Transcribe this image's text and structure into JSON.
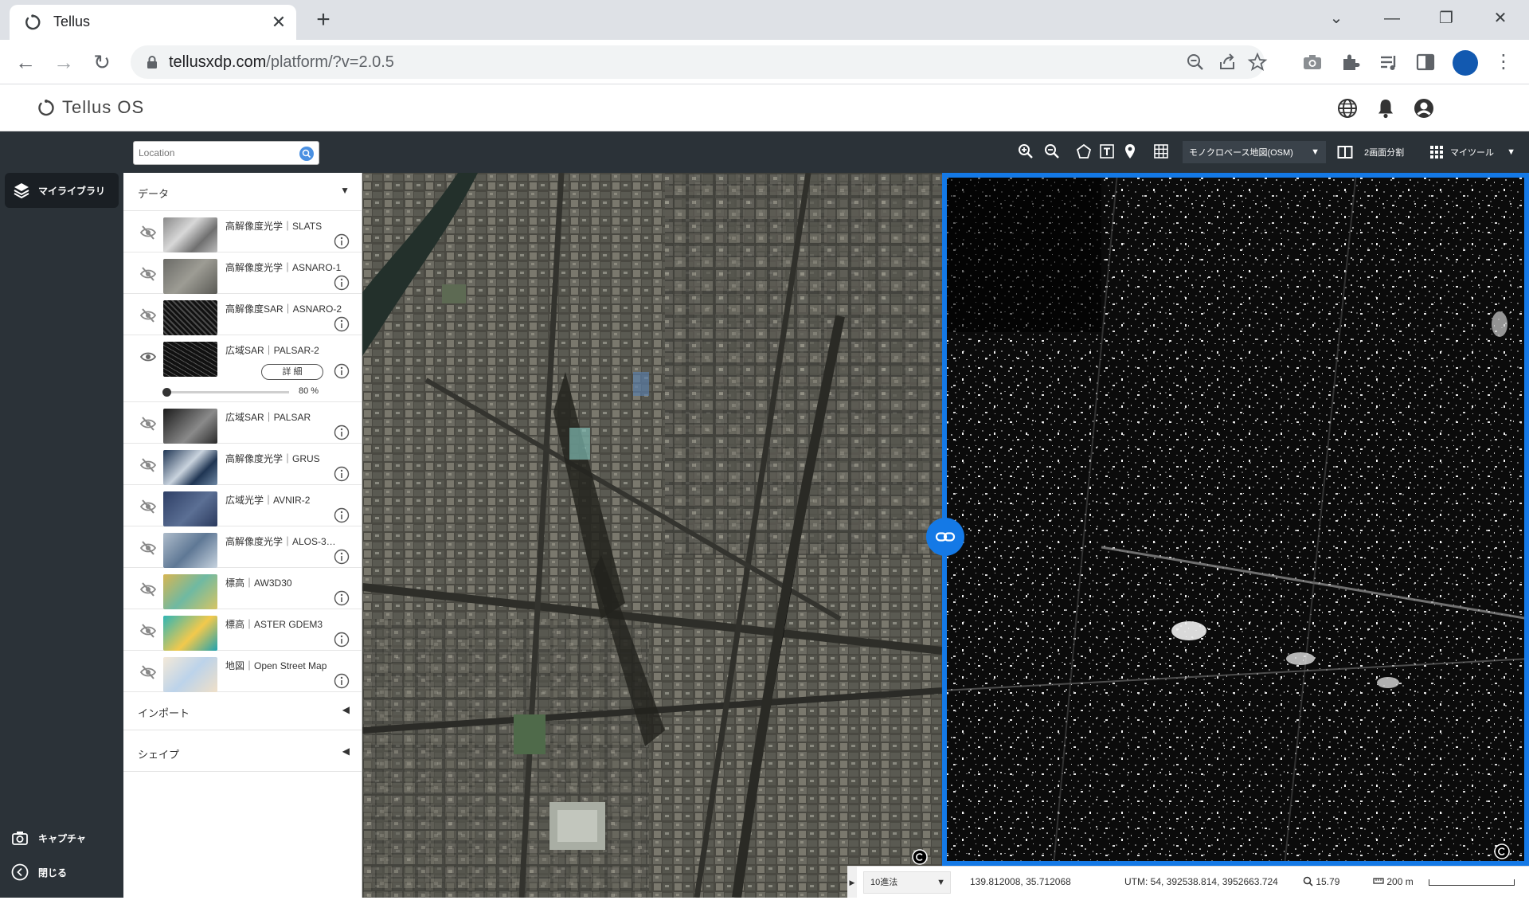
{
  "browser": {
    "tab_title": "Tellus",
    "url_host": "tellusxdp.com",
    "url_path": "/platform/?v=2.0.5"
  },
  "app": {
    "logo_text": "Tellus OS"
  },
  "leftnav": {
    "my_library": "マイライブラリ",
    "capture": "キャプチャ",
    "close": "閉じる"
  },
  "map_toolbar": {
    "search_placeholder": "Location",
    "basemap": "モノクロベース地図(OSM)",
    "split_label": "2画面分割",
    "mytool_label": "マイツール"
  },
  "panel": {
    "data_header": "データ",
    "import_header": "インポート",
    "shape_header": "シェイプ",
    "detail_label": "詳 細",
    "opacity_value": "80",
    "opacity_unit": "%",
    "layers": [
      {
        "name": "高解像度光学｜SLATS",
        "visible": false
      },
      {
        "name": "高解像度光学｜ASNARO-1",
        "visible": false
      },
      {
        "name": "高解像度SAR｜ASNARO-2",
        "visible": false
      },
      {
        "name": "広域SAR｜PALSAR-2",
        "visible": true
      },
      {
        "name": "広域SAR｜PALSAR",
        "visible": false
      },
      {
        "name": "高解像度光学｜GRUS",
        "visible": false
      },
      {
        "name": "広域光学｜AVNIR-2",
        "visible": false
      },
      {
        "name": "高解像度光学｜ALOS-3…",
        "visible": false
      },
      {
        "name": "標高｜AW3D30",
        "visible": false
      },
      {
        "name": "標高｜ASTER GDEM3",
        "visible": false
      },
      {
        "name": "地図｜Open Street Map",
        "visible": false
      }
    ]
  },
  "statusbar": {
    "format": "10進法",
    "coords": "139.812008, 35.712068",
    "utm": "UTM: 54, 392538.814, 3952663.724",
    "zoom": "15.79",
    "scale": "200 m"
  },
  "colors": {
    "accent": "#1479e6",
    "nav_bg": "#2b3238"
  }
}
